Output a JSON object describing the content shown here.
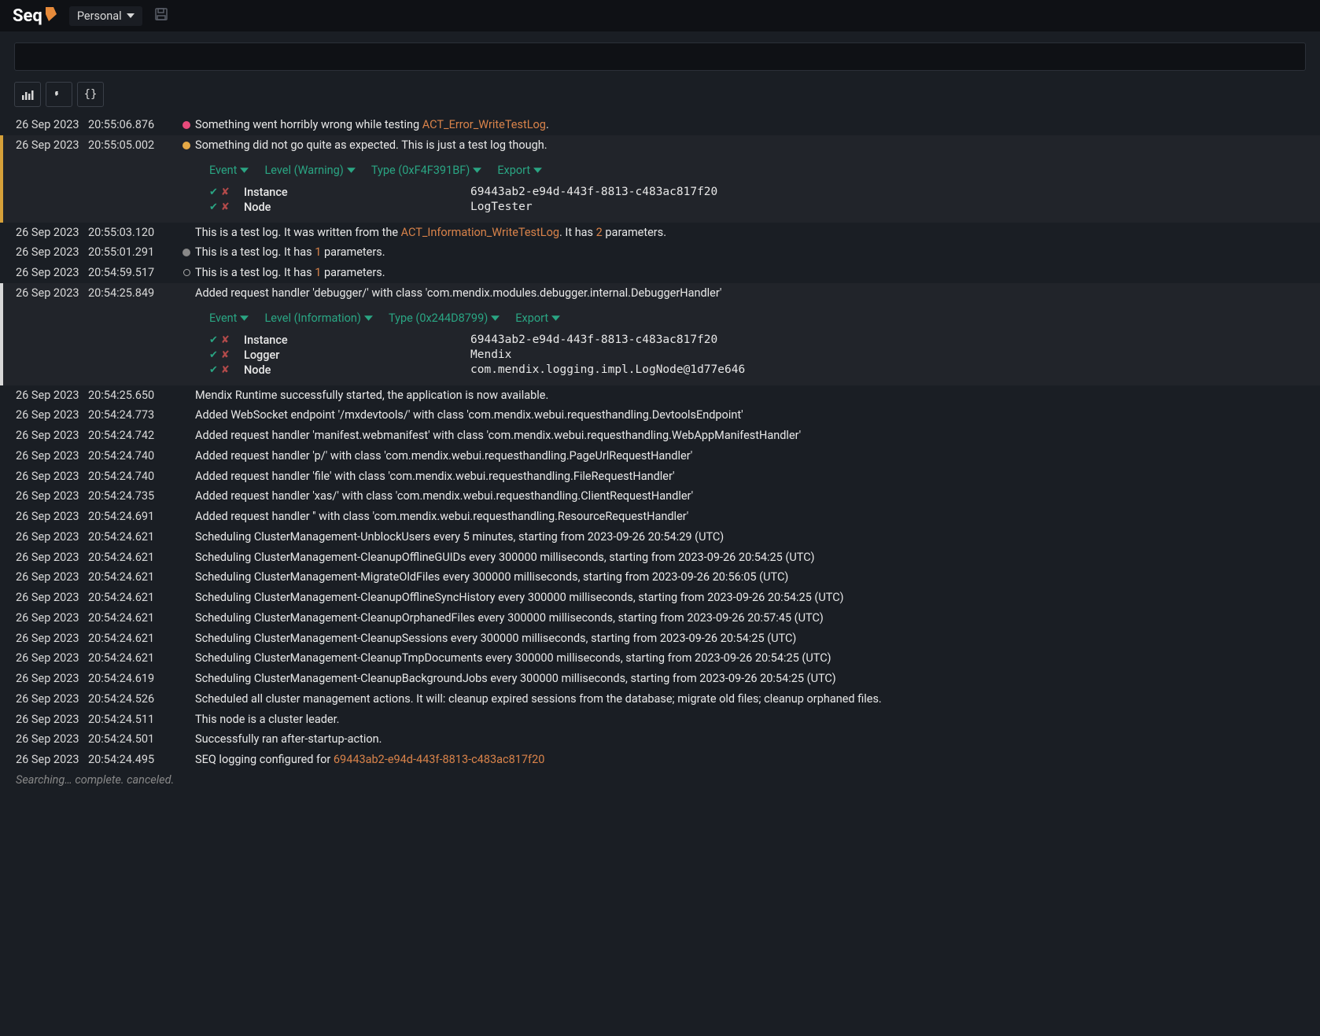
{
  "header": {
    "brand": "Seq",
    "workspace": "Personal"
  },
  "expand_labels": {
    "event": "Event",
    "level_warn": "Level (Warning)",
    "level_info": "Level (Information)",
    "type_warn": "Type (0xF4F391BF)",
    "type_info": "Type (0x244D8799)",
    "export": "Export"
  },
  "events": [
    {
      "date": "26 Sep 2023",
      "time": "20:55:06.876",
      "level": "error",
      "parts": [
        {
          "t": "Something went horribly wrong while testing "
        },
        {
          "t": "ACT_Error_WriteTestLog",
          "link": true
        },
        {
          "t": "."
        }
      ]
    },
    {
      "date": "26 Sep 2023",
      "time": "20:55:05.002",
      "level": "warn",
      "selected": "warn",
      "parts": [
        {
          "t": "Something did not go quite as expected. This is just a test log though."
        }
      ],
      "expand": {
        "level": "warn",
        "type": "warn",
        "props": [
          {
            "k": "Instance",
            "v": "69443ab2-e94d-443f-8813-c483ac817f20"
          },
          {
            "k": "Node",
            "v": "LogTester"
          }
        ]
      }
    },
    {
      "date": "26 Sep 2023",
      "time": "20:55:03.120",
      "level": "none",
      "parts": [
        {
          "t": "This is a test log. It was written from the "
        },
        {
          "t": "ACT_Information_WriteTestLog",
          "link": true
        },
        {
          "t": ". It has "
        },
        {
          "t": "2",
          "link": true
        },
        {
          "t": " parameters."
        }
      ]
    },
    {
      "date": "26 Sep 2023",
      "time": "20:55:01.291",
      "level": "debug",
      "parts": [
        {
          "t": "This is a test log. It has "
        },
        {
          "t": "1",
          "link": true
        },
        {
          "t": " parameters."
        }
      ]
    },
    {
      "date": "26 Sep 2023",
      "time": "20:54:59.517",
      "level": "ring",
      "parts": [
        {
          "t": "This is a test log. It has "
        },
        {
          "t": "1",
          "link": true
        },
        {
          "t": " parameters."
        }
      ]
    },
    {
      "date": "26 Sep 2023",
      "time": "20:54:25.849",
      "level": "none",
      "selected": "info",
      "parts": [
        {
          "t": "Added request handler 'debugger/' with class 'com.mendix.modules.debugger.internal.DebuggerHandler'"
        }
      ],
      "expand": {
        "level": "info",
        "type": "info",
        "props": [
          {
            "k": "Instance",
            "v": "69443ab2-e94d-443f-8813-c483ac817f20"
          },
          {
            "k": "Logger",
            "v": "Mendix"
          },
          {
            "k": "Node",
            "v": "com.mendix.logging.impl.LogNode@1d77e646"
          }
        ]
      }
    },
    {
      "date": "26 Sep 2023",
      "time": "20:54:25.650",
      "level": "none",
      "parts": [
        {
          "t": "Mendix Runtime successfully started, the application is now available."
        }
      ]
    },
    {
      "date": "26 Sep 2023",
      "time": "20:54:24.773",
      "level": "none",
      "parts": [
        {
          "t": "Added WebSocket endpoint '/mxdevtools/' with class 'com.mendix.webui.requesthandling.DevtoolsEndpoint'"
        }
      ]
    },
    {
      "date": "26 Sep 2023",
      "time": "20:54:24.742",
      "level": "none",
      "parts": [
        {
          "t": "Added request handler 'manifest.webmanifest' with class 'com.mendix.webui.requesthandling.WebAppManifestHandler'"
        }
      ]
    },
    {
      "date": "26 Sep 2023",
      "time": "20:54:24.740",
      "level": "none",
      "parts": [
        {
          "t": "Added request handler 'p/' with class 'com.mendix.webui.requesthandling.PageUrlRequestHandler'"
        }
      ]
    },
    {
      "date": "26 Sep 2023",
      "time": "20:54:24.740",
      "level": "none",
      "parts": [
        {
          "t": "Added request handler 'file' with class 'com.mendix.webui.requesthandling.FileRequestHandler'"
        }
      ]
    },
    {
      "date": "26 Sep 2023",
      "time": "20:54:24.735",
      "level": "none",
      "parts": [
        {
          "t": "Added request handler 'xas/' with class 'com.mendix.webui.requesthandling.ClientRequestHandler'"
        }
      ]
    },
    {
      "date": "26 Sep 2023",
      "time": "20:54:24.691",
      "level": "none",
      "parts": [
        {
          "t": "Added request handler '' with class 'com.mendix.webui.requesthandling.ResourceRequestHandler'"
        }
      ]
    },
    {
      "date": "26 Sep 2023",
      "time": "20:54:24.621",
      "level": "none",
      "parts": [
        {
          "t": "Scheduling ClusterManagement-UnblockUsers every 5 minutes, starting from 2023-09-26 20:54:29 (UTC)"
        }
      ]
    },
    {
      "date": "26 Sep 2023",
      "time": "20:54:24.621",
      "level": "none",
      "parts": [
        {
          "t": "Scheduling ClusterManagement-CleanupOfflineGUIDs every 300000 milliseconds, starting from 2023-09-26 20:54:25 (UTC)"
        }
      ]
    },
    {
      "date": "26 Sep 2023",
      "time": "20:54:24.621",
      "level": "none",
      "parts": [
        {
          "t": "Scheduling ClusterManagement-MigrateOldFiles every 300000 milliseconds, starting from 2023-09-26 20:56:05 (UTC)"
        }
      ]
    },
    {
      "date": "26 Sep 2023",
      "time": "20:54:24.621",
      "level": "none",
      "parts": [
        {
          "t": "Scheduling ClusterManagement-CleanupOfflineSyncHistory every 300000 milliseconds, starting from 2023-09-26 20:54:25 (UTC)"
        }
      ]
    },
    {
      "date": "26 Sep 2023",
      "time": "20:54:24.621",
      "level": "none",
      "parts": [
        {
          "t": "Scheduling ClusterManagement-CleanupOrphanedFiles every 300000 milliseconds, starting from 2023-09-26 20:57:45 (UTC)"
        }
      ]
    },
    {
      "date": "26 Sep 2023",
      "time": "20:54:24.621",
      "level": "none",
      "parts": [
        {
          "t": "Scheduling ClusterManagement-CleanupSessions every 300000 milliseconds, starting from 2023-09-26 20:54:25 (UTC)"
        }
      ]
    },
    {
      "date": "26 Sep 2023",
      "time": "20:54:24.621",
      "level": "none",
      "parts": [
        {
          "t": "Scheduling ClusterManagement-CleanupTmpDocuments every 300000 milliseconds, starting from 2023-09-26 20:54:25 (UTC)"
        }
      ]
    },
    {
      "date": "26 Sep 2023",
      "time": "20:54:24.619",
      "level": "none",
      "parts": [
        {
          "t": "Scheduling ClusterManagement-CleanupBackgroundJobs every 300000 milliseconds, starting from 2023-09-26 20:54:25 (UTC)"
        }
      ]
    },
    {
      "date": "26 Sep 2023",
      "time": "20:54:24.526",
      "level": "none",
      "parts": [
        {
          "t": "Scheduled all cluster management actions. It will: cleanup expired sessions from the database; migrate old files; cleanup orphaned files."
        }
      ]
    },
    {
      "date": "26 Sep 2023",
      "time": "20:54:24.511",
      "level": "none",
      "parts": [
        {
          "t": "This node is a cluster leader."
        }
      ]
    },
    {
      "date": "26 Sep 2023",
      "time": "20:54:24.501",
      "level": "none",
      "parts": [
        {
          "t": "Successfully ran after-startup-action."
        }
      ]
    },
    {
      "date": "26 Sep 2023",
      "time": "20:54:24.495",
      "level": "none",
      "parts": [
        {
          "t": "SEQ logging configured for "
        },
        {
          "t": "69443ab2-e94d-443f-8813-c483ac817f20",
          "link": true
        }
      ]
    }
  ],
  "status": "Searching… complete. canceled."
}
